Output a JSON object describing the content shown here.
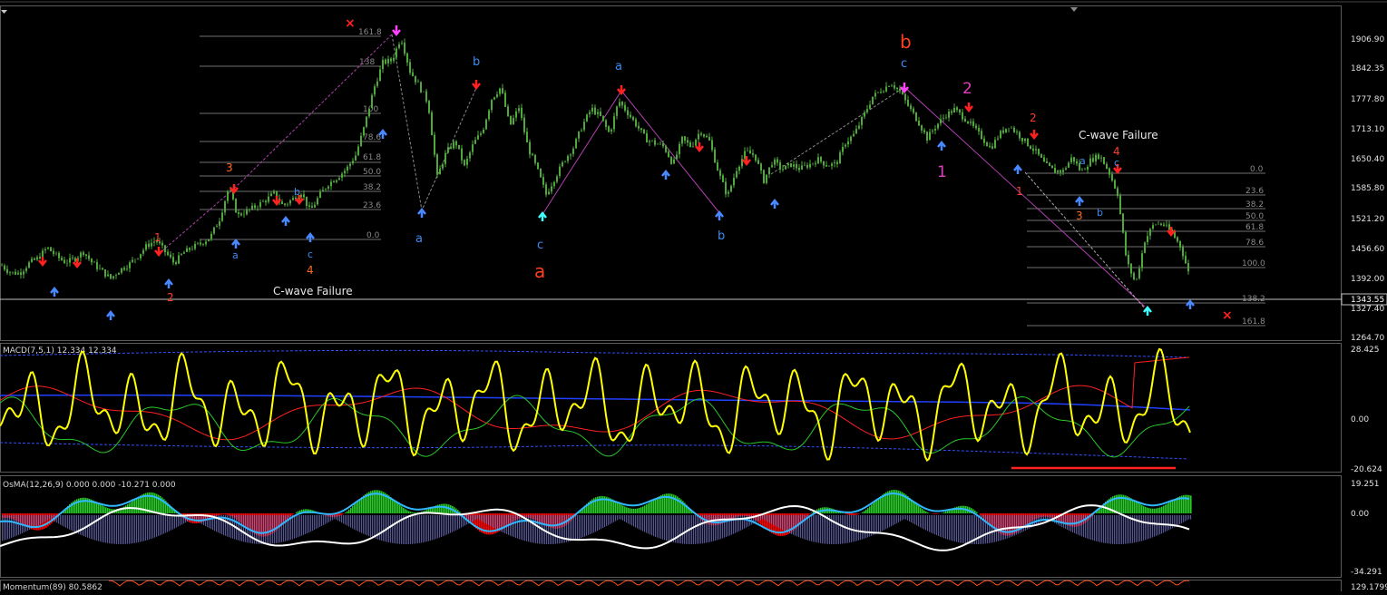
{
  "colors": {
    "background": "#000000",
    "candle": "#4fa83a",
    "grid": "#3c3c3c",
    "fib": "#6f6f6f",
    "price_line": "#c0c0c0",
    "red_label": "#ff3c2a",
    "blue_label": "#3c8cf0",
    "magenta_label": "#e040c0",
    "down_arrow": "#ff2020",
    "up_arrow": "#4a88ff",
    "cyan_arrow": "#40ffff",
    "macd_main": "#ffff00",
    "macd_signal": "#ff2020",
    "macd_green": "#28c828",
    "macd_blue": "#2040ff",
    "osma_green": "#28c828",
    "osma_red": "#ff0000",
    "osma_cyan": "#30b8ff",
    "osma_white": "#ffffff"
  },
  "price_panel": {
    "y_axis_labels": [
      "1906.90",
      "1842.35",
      "1777.80",
      "1713.10",
      "1650.40",
      "1585.80",
      "1521.20",
      "1456.60",
      "1392.00",
      "1327.40",
      "1264.70"
    ],
    "current_price": "1343.55",
    "left_fib_levels": [
      "161.8",
      "138",
      "100",
      "78.6",
      "61.8",
      "50.0",
      "38.2",
      "23.6",
      "0.0"
    ],
    "right_fib_levels": [
      "0.0",
      "23.6",
      "38.2",
      "50.0",
      "61.8",
      "78.6",
      "100.0",
      "138.2",
      "161.8"
    ],
    "wave_labels": [
      {
        "text": "1",
        "color": "red"
      },
      {
        "text": "2",
        "color": "red"
      },
      {
        "text": "3",
        "color": "orange"
      },
      {
        "text": "4",
        "color": "orange"
      },
      {
        "text": "a",
        "color": "blue"
      },
      {
        "text": "b",
        "color": "blue"
      },
      {
        "text": "c",
        "color": "blue"
      },
      {
        "text": "a",
        "color": "blue"
      },
      {
        "text": "b",
        "color": "blue"
      },
      {
        "text": "c",
        "color": "blue"
      },
      {
        "text": "a",
        "color": "blue"
      },
      {
        "text": "b",
        "color": "blue"
      },
      {
        "text": "c",
        "color": "blue"
      },
      {
        "text": "a",
        "color": "red"
      },
      {
        "text": "b",
        "color": "red"
      },
      {
        "text": "1",
        "color": "magenta"
      },
      {
        "text": "2",
        "color": "magenta"
      },
      {
        "text": "2",
        "color": "red"
      },
      {
        "text": "1",
        "color": "red"
      },
      {
        "text": "3",
        "color": "orange"
      },
      {
        "text": "4",
        "color": "red"
      },
      {
        "text": "a",
        "color": "blue"
      },
      {
        "text": "b",
        "color": "blue"
      },
      {
        "text": "c",
        "color": "blue"
      }
    ],
    "annotations": [
      "C-wave Failure",
      "C-wave Failure"
    ]
  },
  "macd_panel": {
    "title": "MACD(7,5,1) 12.334 12.334",
    "y_axis_labels": [
      "28.425",
      "0.00",
      "-20.624"
    ]
  },
  "osma_panel": {
    "title": "OsMA(12,26,9) 0.000 0.000 -10.271 0.000",
    "y_axis_labels": [
      "19.251",
      "0.00",
      "-34.291"
    ]
  },
  "momentum_panel": {
    "title": "Momentum(89) 80.5862",
    "y_axis_labels": [
      "129.1799"
    ]
  },
  "chart_data": {
    "type": "candlestick",
    "title": "",
    "ylim": [
      1264.7,
      1925
    ],
    "x": [
      0,
      10,
      20,
      30,
      40,
      50,
      60,
      70,
      80,
      90,
      100,
      110,
      120,
      130,
      140,
      150,
      160,
      170,
      180,
      190,
      200,
      210,
      220,
      230,
      240,
      250,
      260,
      270,
      280,
      290,
      300,
      310,
      320,
      330,
      340,
      350,
      360,
      370,
      380,
      390,
      400,
      410,
      420,
      430,
      440,
      450,
      460,
      470,
      480,
      490,
      500,
      510,
      520,
      530,
      540,
      550,
      560,
      570,
      580,
      590,
      600,
      610,
      620,
      630,
      640,
      650,
      660,
      670,
      680,
      690,
      700,
      710,
      720,
      730,
      740,
      750,
      760,
      770,
      780,
      790,
      800,
      810,
      820,
      830,
      840,
      850,
      860,
      870,
      880,
      890,
      900,
      910,
      920,
      930,
      940,
      950,
      960,
      970,
      980,
      990,
      1000,
      1010,
      1020,
      1030,
      1040,
      1050,
      1060,
      1070,
      1080,
      1090,
      1100,
      1110,
      1120,
      1130,
      1140,
      1150,
      1160,
      1170,
      1180,
      1190,
      1200,
      1210,
      1220,
      1230,
      1240,
      1250,
      1260,
      1270,
      1280,
      1290,
      1300,
      1310
    ],
    "close": [
      1372,
      1355,
      1355,
      1378,
      1390,
      1415,
      1395,
      1380,
      1388,
      1405,
      1378,
      1360,
      1342,
      1362,
      1375,
      1395,
      1420,
      1432,
      1405,
      1378,
      1402,
      1415,
      1425,
      1440,
      1482,
      1555,
      1490,
      1500,
      1512,
      1525,
      1542,
      1513,
      1528,
      1545,
      1500,
      1537,
      1565,
      1580,
      1600,
      1632,
      1702,
      1788,
      1850,
      1855,
      1910,
      1830,
      1795,
      1755,
      1580,
      1640,
      1665,
      1605,
      1660,
      1690,
      1765,
      1792,
      1700,
      1745,
      1650,
      1600,
      1540,
      1580,
      1620,
      1650,
      1702,
      1742,
      1722,
      1682,
      1760,
      1732,
      1702,
      1670,
      1660,
      1652,
      1610,
      1670,
      1652,
      1690,
      1665,
      1592,
      1535,
      1600,
      1640,
      1632,
      1572,
      1620,
      1598,
      1610,
      1600,
      1610,
      1622,
      1608,
      1612,
      1662,
      1682,
      1725,
      1770,
      1785,
      1802,
      1782,
      1745,
      1712,
      1672,
      1702,
      1725,
      1740,
      1722,
      1700,
      1675,
      1648,
      1682,
      1702,
      1682,
      1660,
      1640,
      1610,
      1595,
      1595,
      1628,
      1592,
      1620,
      1632,
      1595,
      1542,
      1382,
      1330,
      1432,
      1470,
      1470,
      1450,
      1415,
      1342
    ],
    "macd_main_series": "MACD(7,5,1)",
    "osma_series": "OsMA(12,26,9)",
    "momentum_series": "Momentum(89)"
  }
}
